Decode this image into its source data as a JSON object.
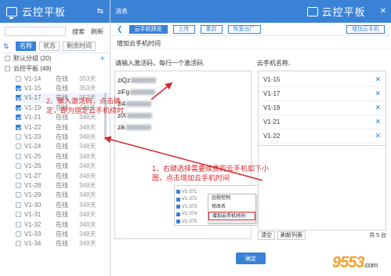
{
  "left": {
    "title": "云控平板",
    "swap_icon": "swap-icon",
    "search_button": "搜索",
    "refresh_button": "刷新",
    "tabs": [
      "名称",
      "状态",
      "剩余时间"
    ],
    "groups": [
      {
        "label": "默认分组 (20)"
      },
      {
        "label": "云控平板 (49)"
      }
    ],
    "devices": [
      {
        "name": "V1-14",
        "status": "在线",
        "days": "353天",
        "checked": false
      },
      {
        "name": "V1-15",
        "status": "在线",
        "days": "353天",
        "checked": true
      },
      {
        "name": "V1-17",
        "status": "在线",
        "days": "352天",
        "checked": true,
        "selected": true
      },
      {
        "name": "V1-19",
        "status": "在线",
        "days": "349天",
        "checked": true
      },
      {
        "name": "V1-21",
        "status": "在线",
        "days": "348天",
        "checked": true
      },
      {
        "name": "V1-22",
        "status": "在线",
        "days": "348天",
        "checked": true
      },
      {
        "name": "V1-23",
        "status": "在线",
        "days": "348天",
        "checked": false
      },
      {
        "name": "V1-24",
        "status": "在线",
        "days": "348天",
        "checked": false
      },
      {
        "name": "V1-25",
        "status": "在线",
        "days": "348天",
        "checked": false
      },
      {
        "name": "V1-26",
        "status": "在线",
        "days": "348天",
        "checked": false
      },
      {
        "name": "V1-27",
        "status": "在线",
        "days": "348天",
        "checked": false
      },
      {
        "name": "V1-28",
        "status": "在线",
        "days": "348天",
        "checked": false
      },
      {
        "name": "V1-29",
        "status": "在线",
        "days": "348天",
        "checked": false
      },
      {
        "name": "V1-30",
        "status": "在线",
        "days": "348天",
        "checked": false
      },
      {
        "name": "V1-31",
        "status": "在线",
        "days": "348天",
        "checked": false
      },
      {
        "name": "V1-32",
        "status": "在线",
        "days": "348天",
        "checked": false
      },
      {
        "name": "V1-33",
        "status": "在线",
        "days": "348天",
        "checked": false
      },
      {
        "name": "V1-34",
        "status": "在线",
        "days": "348天",
        "checked": false
      }
    ]
  },
  "right": {
    "message": "消息",
    "title": "云控平板",
    "toolbar": [
      "云手机预览",
      "上传",
      "重启",
      "恢复出厂"
    ],
    "toolbar_far": "增加云手机",
    "dialog_title": "增加云手机时间",
    "left_label": "请输入激活码，每行一个激活码.",
    "right_label": "云手机名称.",
    "codes": [
      "ziQz",
      "ziFg",
      "zi4",
      "ziX",
      "zik"
    ],
    "devices": [
      "V1-15",
      "V1-17",
      "V1-19",
      "V1-21",
      "V1-22"
    ],
    "clear_button": "清空",
    "refresh_list_button": "刷新列表",
    "total": "共 5 台",
    "confirm_button": "确定"
  },
  "annotations": {
    "step2": "2、输入激活码，点击确定，即为指定云手机续时",
    "step1": "1、右键选择需要续费的云手机如下小图，点击增加云手机时间"
  },
  "inset": {
    "rows": [
      "V1-371",
      "V1-372",
      "V1-373",
      "V1-374",
      "V1-375"
    ],
    "menu": [
      "远程控制",
      "修改名",
      "增加云手机时间"
    ]
  },
  "watermark": {
    "text": "9553",
    "suffix": ".com"
  },
  "colors": {
    "accent": "#3a82d6",
    "annotation": "#d7262b"
  }
}
